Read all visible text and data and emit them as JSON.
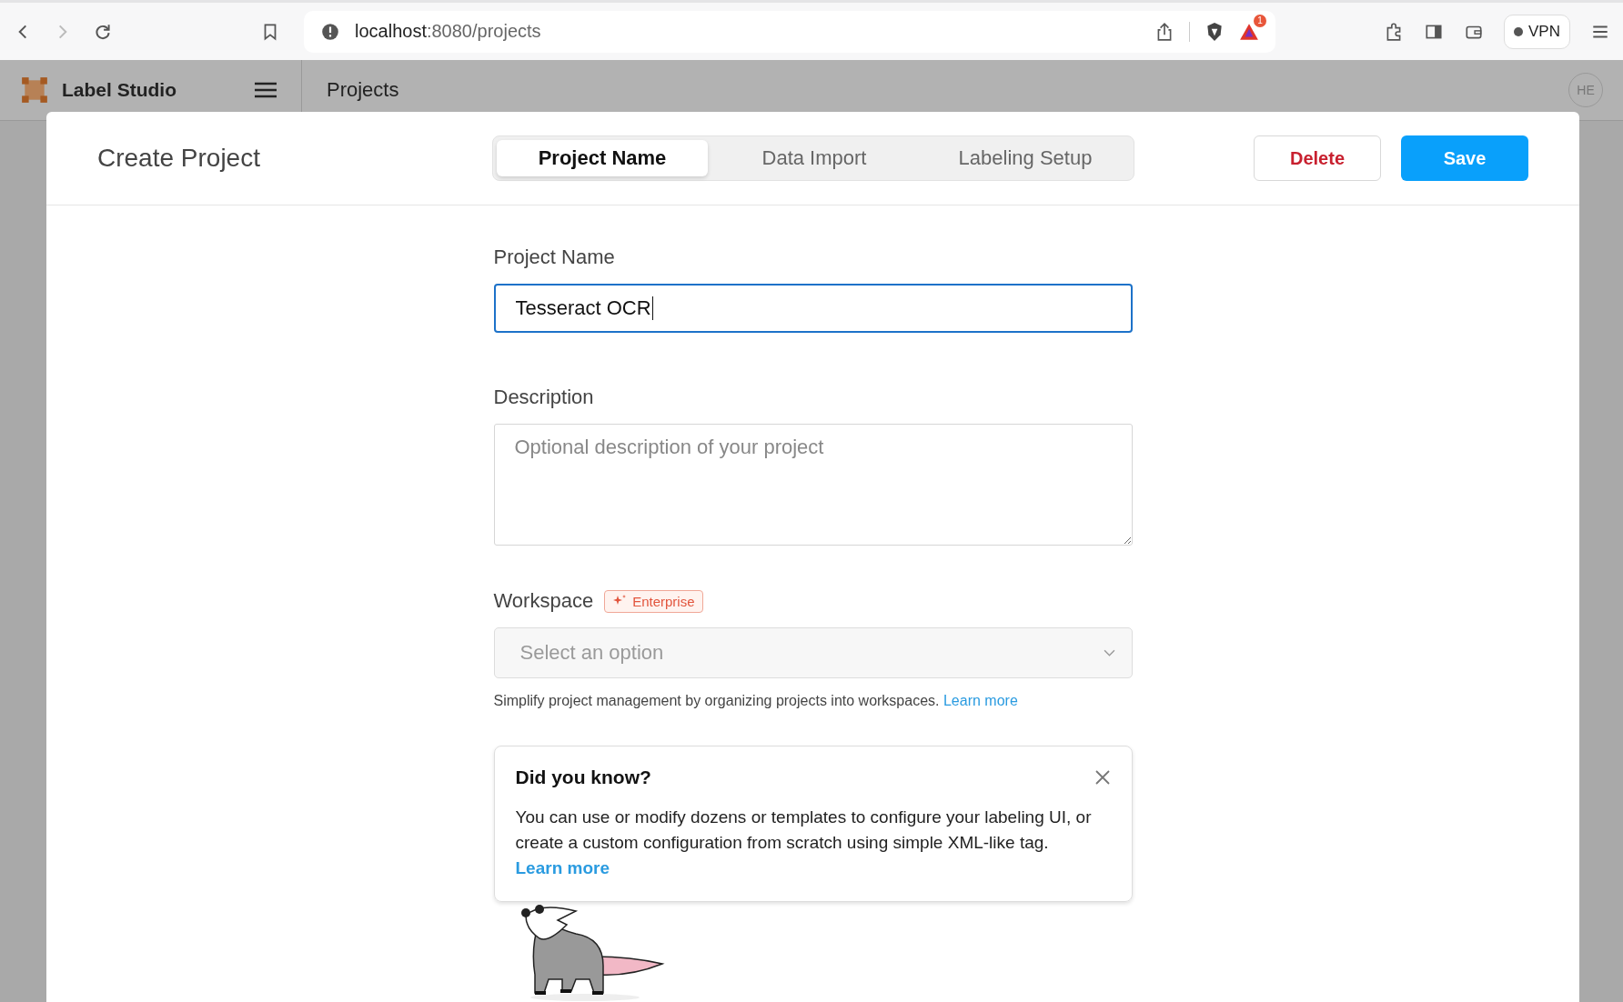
{
  "browser": {
    "url_host": "localhost",
    "url_rest": ":8080/projects",
    "notification_count": "1",
    "vpn_label": "VPN"
  },
  "app": {
    "brand": "Label Studio",
    "page_title": "Projects",
    "avatar": "HE"
  },
  "dialog": {
    "title": "Create Project",
    "tabs": [
      {
        "label": "Project Name",
        "selected": true
      },
      {
        "label": "Data Import",
        "selected": false
      },
      {
        "label": "Labeling Setup",
        "selected": false
      }
    ],
    "delete_button": "Delete",
    "save_button": "Save",
    "project_name": {
      "label": "Project Name",
      "value": "Tesseract OCR"
    },
    "description": {
      "label": "Description",
      "placeholder": "Optional description of your project"
    },
    "workspace": {
      "label": "Workspace",
      "badge": "Enterprise",
      "placeholder": "Select an option",
      "help": "Simplify project management by organizing projects into workspaces.",
      "help_link": "Learn more"
    },
    "tip": {
      "title": "Did you know?",
      "text": "You can use or modify dozens or templates to configure your labeling UI, or create a custom configuration from scratch using simple XML-like tag.",
      "link": "Learn more"
    }
  }
}
